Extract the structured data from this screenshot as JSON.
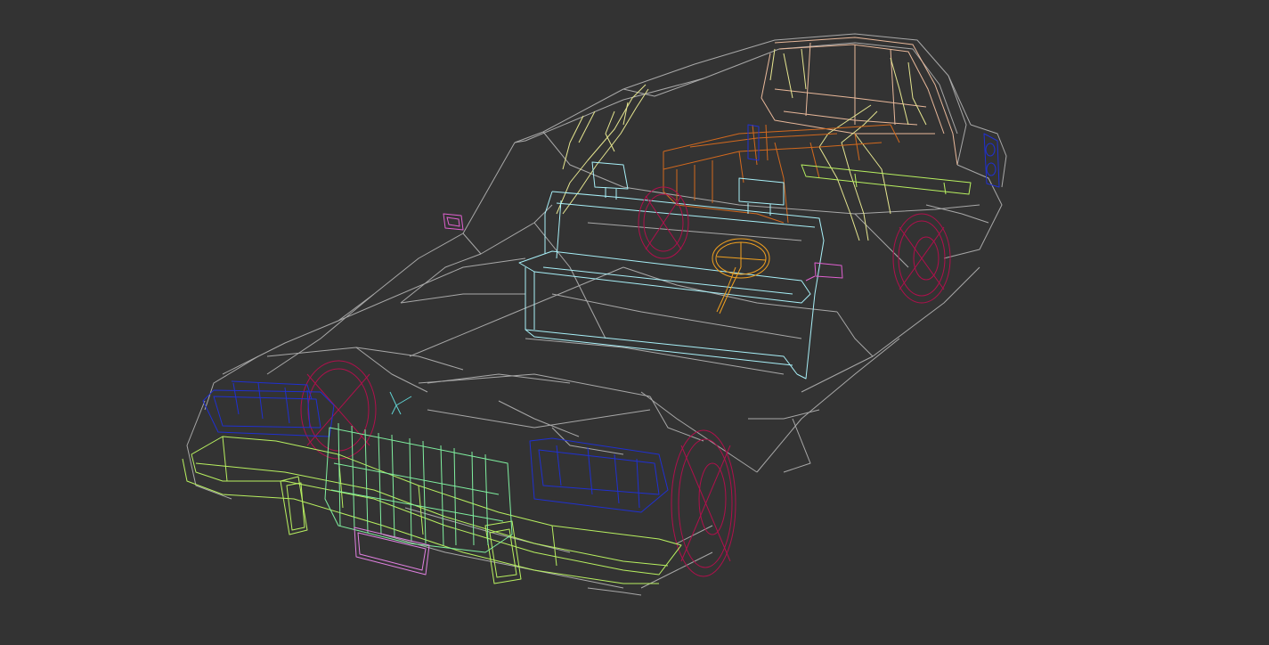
{
  "viewport": {
    "background": "#333333",
    "render_mode": "wireframe",
    "subject": "car-model"
  },
  "colors": {
    "body": "#a8a8a8",
    "roof_frame": "#e8b89a",
    "pillars": "#e6e690",
    "seats_rear": "#d2691e",
    "seat_front": "#a8f0f8",
    "steering_wheel": "#f0a020",
    "wheels": "#b0104c",
    "mirrors": "#e060d0",
    "lights": "#2030d0",
    "bumper": "#b8f060",
    "grille": "#80f0a0",
    "hood_ornament": "#60d0d0",
    "license_plate": "#e080e0"
  }
}
